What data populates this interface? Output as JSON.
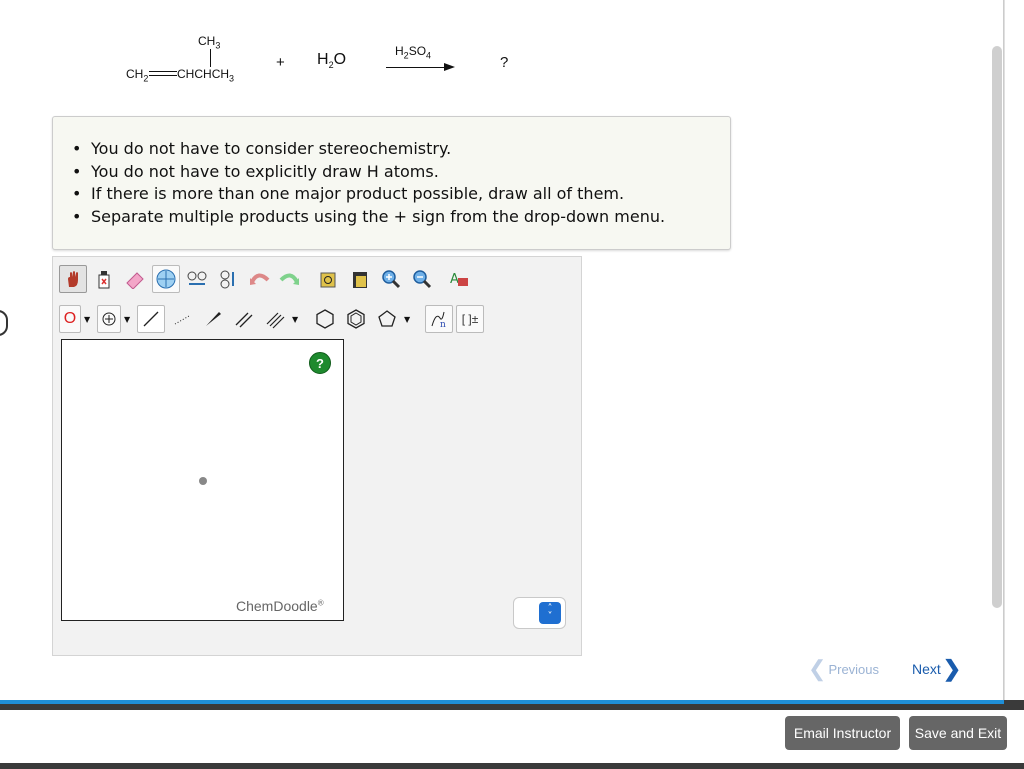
{
  "reaction": {
    "reactant_top": "CH3",
    "reactant_left": "CH2",
    "reactant_right": "CHCHCH3",
    "plus": "+",
    "water": "H2O",
    "catalyst": "H2SO4",
    "product": "?"
  },
  "instructions": [
    "You do not have to consider stereochemistry.",
    "You do not have to explicitly draw H atoms.",
    "If there is more than one major product possible, draw all of them.",
    "Separate multiple products using the + sign from the drop-down menu."
  ],
  "editor": {
    "atom_selector": "O",
    "help_label": "?",
    "brand": "ChemDoodle",
    "brand_mark": "®",
    "bracket_tool": "[ ]±",
    "icons": [
      "hand-icon",
      "clear-icon",
      "eraser-icon",
      "center-icon",
      "flip-icon",
      "flip-vertical-icon",
      "undo-icon",
      "redo-icon",
      "copy-icon",
      "paste-icon",
      "zoom-in-icon",
      "zoom-out-icon",
      "clean-icon"
    ]
  },
  "navigation": {
    "previous": "Previous",
    "next": "Next"
  },
  "footer": {
    "email": "Email Instructor",
    "save": "Save and Exit"
  }
}
